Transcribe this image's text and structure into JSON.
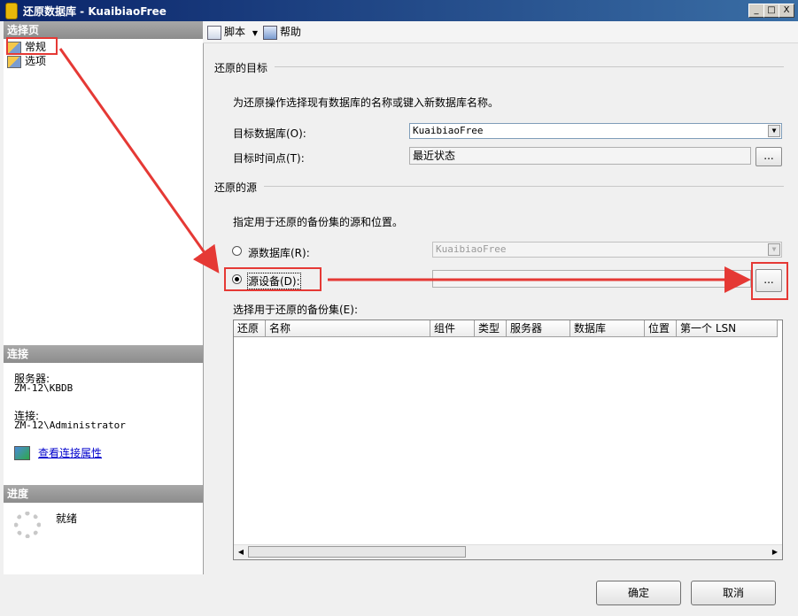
{
  "window": {
    "title": "还原数据库 - KuaibiaoFree",
    "min": "_",
    "max": "□",
    "close": "X"
  },
  "left": {
    "select_page_header": "选择页",
    "nav": [
      {
        "label": "常规"
      },
      {
        "label": "选项"
      }
    ],
    "connection_header": "连接",
    "server_label": "服务器:",
    "server_value": "ZM-12\\KBDB",
    "connect_label": "连接:",
    "connect_value": "ZM-12\\Administrator",
    "view_props_link": "查看连接属性",
    "progress_header": "进度",
    "progress_status": "就绪"
  },
  "toolbar": {
    "script_label": "脚本",
    "help_label": "帮助"
  },
  "target": {
    "group_title": "还原的目标",
    "description": "为还原操作选择现有数据库的名称或键入新数据库名称。",
    "db_label": "目标数据库(O):",
    "db_value": "KuaibiaoFree",
    "time_label": "目标时间点(T):",
    "time_value": "最近状态",
    "browse": "..."
  },
  "source": {
    "group_title": "还原的源",
    "description": "指定用于还原的备份集的源和位置。",
    "from_db_label": "源数据库(R):",
    "from_db_value": "KuaibiaoFree",
    "from_device_label": "源设备(D):",
    "device_value": "",
    "browse": "..."
  },
  "backupsets": {
    "label": "选择用于还原的备份集(E):",
    "columns": [
      "还原",
      "名称",
      "组件",
      "类型",
      "服务器",
      "数据库",
      "位置",
      "第一个 LSN"
    ]
  },
  "buttons": {
    "ok": "确定",
    "cancel": "取消"
  },
  "colors": {
    "annotation": "#e53935",
    "title_bar": "#0a246a",
    "link": "#0000cc"
  }
}
